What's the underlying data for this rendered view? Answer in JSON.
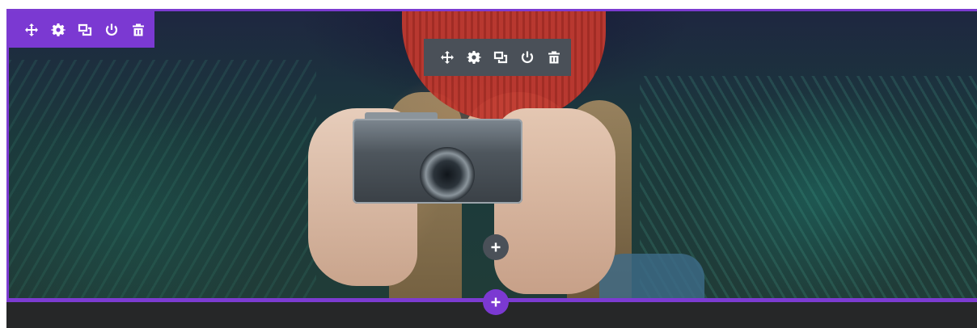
{
  "section": {
    "accent_color": "#7b39d2",
    "toolbar": {
      "buttons": [
        {
          "icon": "move-icon"
        },
        {
          "icon": "gear-icon"
        },
        {
          "icon": "duplicate-icon"
        },
        {
          "icon": "power-icon"
        },
        {
          "icon": "trash-icon"
        }
      ]
    },
    "add_button_icon": "plus-icon"
  },
  "row": {
    "toolbar_color": "#4a5058",
    "toolbar": {
      "buttons": [
        {
          "icon": "move-icon"
        },
        {
          "icon": "gear-icon"
        },
        {
          "icon": "duplicate-icon"
        },
        {
          "icon": "power-icon"
        },
        {
          "icon": "trash-icon"
        }
      ]
    },
    "add_module_icon": "plus-icon"
  },
  "hero_image": {
    "subject": "photo"
  }
}
